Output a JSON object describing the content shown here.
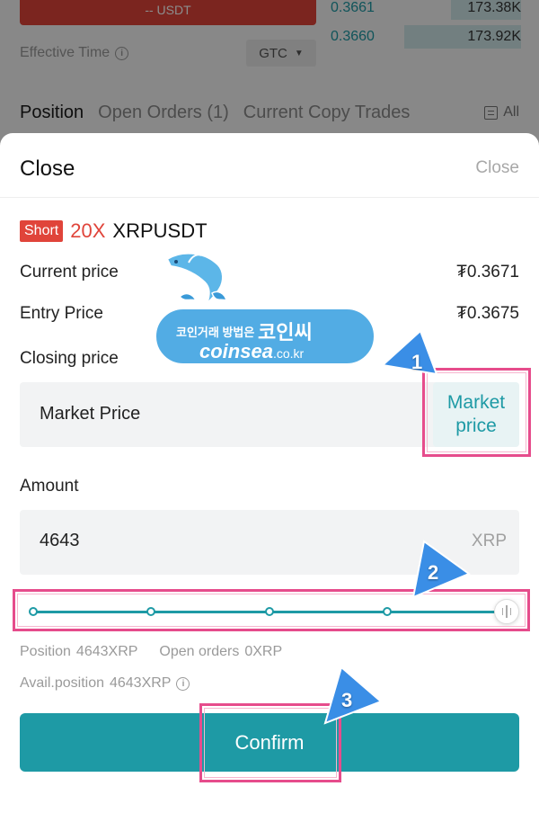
{
  "background": {
    "order_button_label": "-- USDT",
    "effective_time_label": "Effective Time",
    "tif_value": "GTC",
    "orderbook": [
      {
        "price": "0.3661",
        "amount": "173.38K",
        "depth": 0.55
      },
      {
        "price": "0.3660",
        "amount": "173.92K",
        "depth": 0.75
      }
    ],
    "tabs": [
      "Position",
      "Open Orders (1)",
      "Current Copy Trades"
    ],
    "all_label": "All"
  },
  "sheet": {
    "title": "Close",
    "close_label": "Close",
    "position": {
      "side": "Short",
      "leverage": "20X",
      "symbol": "XRPUSDT"
    },
    "current_price_label": "Current price",
    "current_price_value": "₮0.3671",
    "entry_price_label": "Entry Price",
    "entry_price_value": "₮0.3675",
    "closing_price_label": "Closing price",
    "closing_price_value": "Market Price",
    "market_price_button": "Market price",
    "amount_label": "Amount",
    "amount_value": "4643",
    "amount_unit": "XRP",
    "slider_fraction": 1.0,
    "position_label": "Position",
    "position_value": "4643XRP",
    "open_orders_label": "Open orders",
    "open_orders_value": "0XRP",
    "avail_label": "Avail.position",
    "avail_value": "4643XRP",
    "confirm_label": "Confirm"
  },
  "annotations": {
    "steps": [
      "1",
      "2",
      "3"
    ],
    "highlight_color": "#e64c8c",
    "arrow_color": "#3a8ee6"
  },
  "watermark": {
    "korean_text": "코인거래 방법은",
    "korean_brand": "코인씨",
    "english": "coinsea",
    "domain": ".co.kr"
  },
  "colors": {
    "accent": "#1e9aa5",
    "short_red": "#e0443a",
    "muted_text": "#9a9a9a"
  }
}
